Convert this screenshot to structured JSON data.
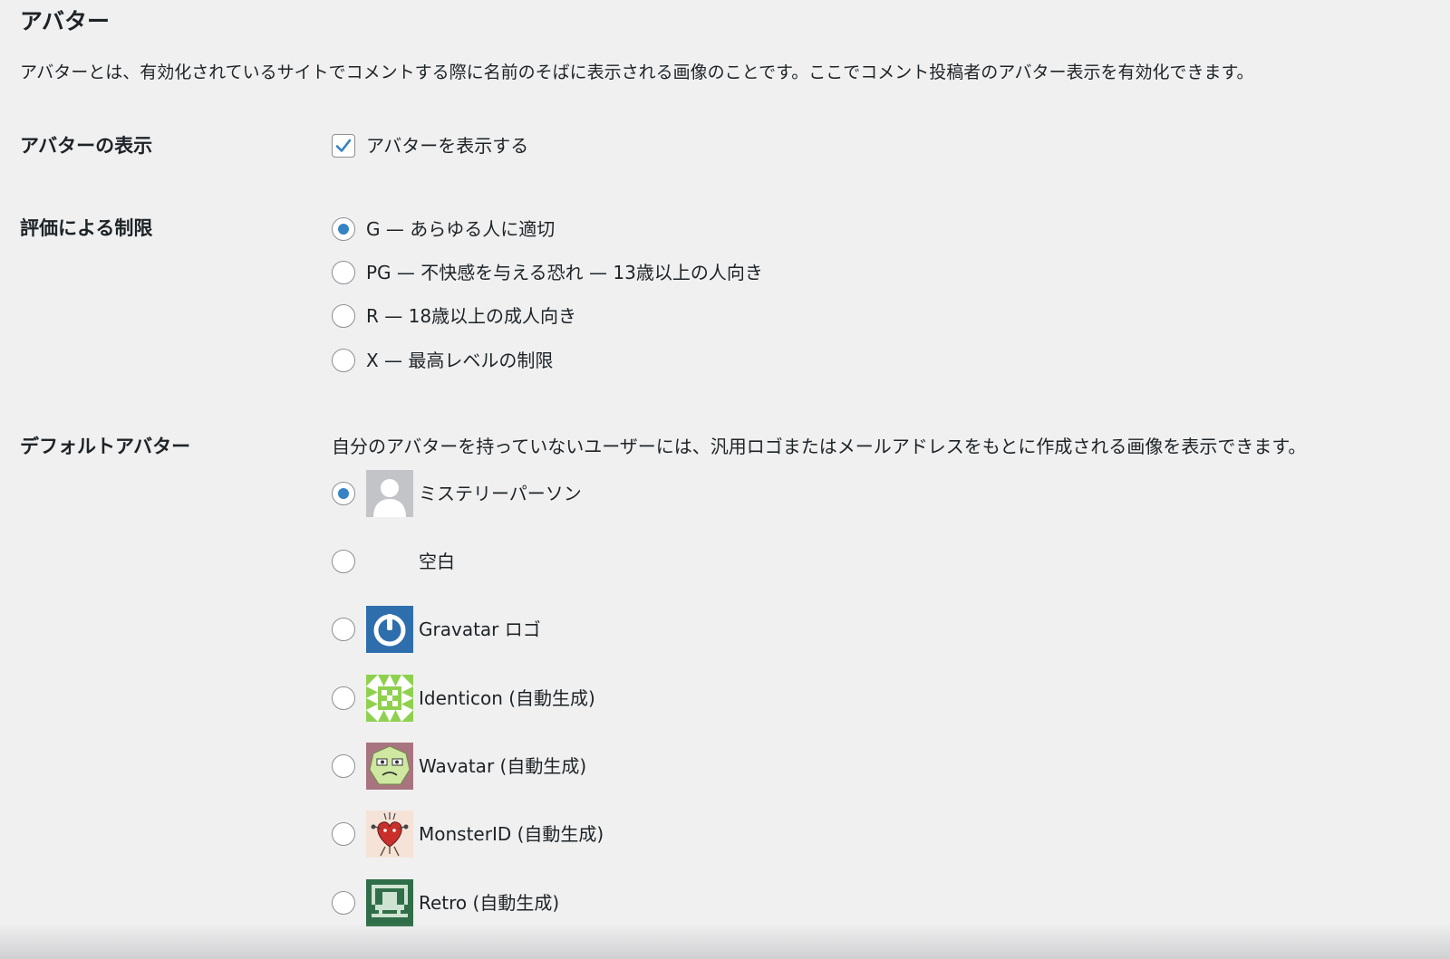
{
  "section": {
    "title": "アバター",
    "description": "アバターとは、有効化されているサイトでコメントする際に名前のそばに表示される画像のことです。ここでコメント投稿者のアバター表示を有効化できます。"
  },
  "display": {
    "label": "アバターの表示",
    "checkbox_label": "アバターを表示する",
    "checked": true
  },
  "rating": {
    "label": "評価による制限",
    "options": [
      {
        "label": "G — あらゆる人に適切",
        "checked": true
      },
      {
        "label": "PG — 不快感を与える恐れ — 13歳以上の人向き",
        "checked": false
      },
      {
        "label": "R — 18歳以上の成人向き",
        "checked": false
      },
      {
        "label": "X — 最高レベルの制限",
        "checked": false
      }
    ]
  },
  "default_avatar": {
    "label": "デフォルトアバター",
    "hint": "自分のアバターを持っていないユーザーには、汎用ロゴまたはメールアドレスをもとに作成される画像を表示できます。",
    "options": [
      {
        "label": "ミステリーパーソン",
        "icon": "mystery-person-icon",
        "checked": true
      },
      {
        "label": "空白",
        "icon": "blank-icon",
        "checked": false
      },
      {
        "label": "Gravatar ロゴ",
        "icon": "gravatar-logo-icon",
        "checked": false
      },
      {
        "label": "Identicon (自動生成)",
        "icon": "identicon-icon",
        "checked": false
      },
      {
        "label": "Wavatar (自動生成)",
        "icon": "wavatar-icon",
        "checked": false
      },
      {
        "label": "MonsterID (自動生成)",
        "icon": "monsterid-icon",
        "checked": false
      },
      {
        "label": "Retro (自動生成)",
        "icon": "retro-icon",
        "checked": false
      }
    ]
  },
  "colors": {
    "accent": "#3582c4",
    "background": "#f0f0f1",
    "text": "#1d2327",
    "gravatar_blue": "#2e6ead"
  }
}
